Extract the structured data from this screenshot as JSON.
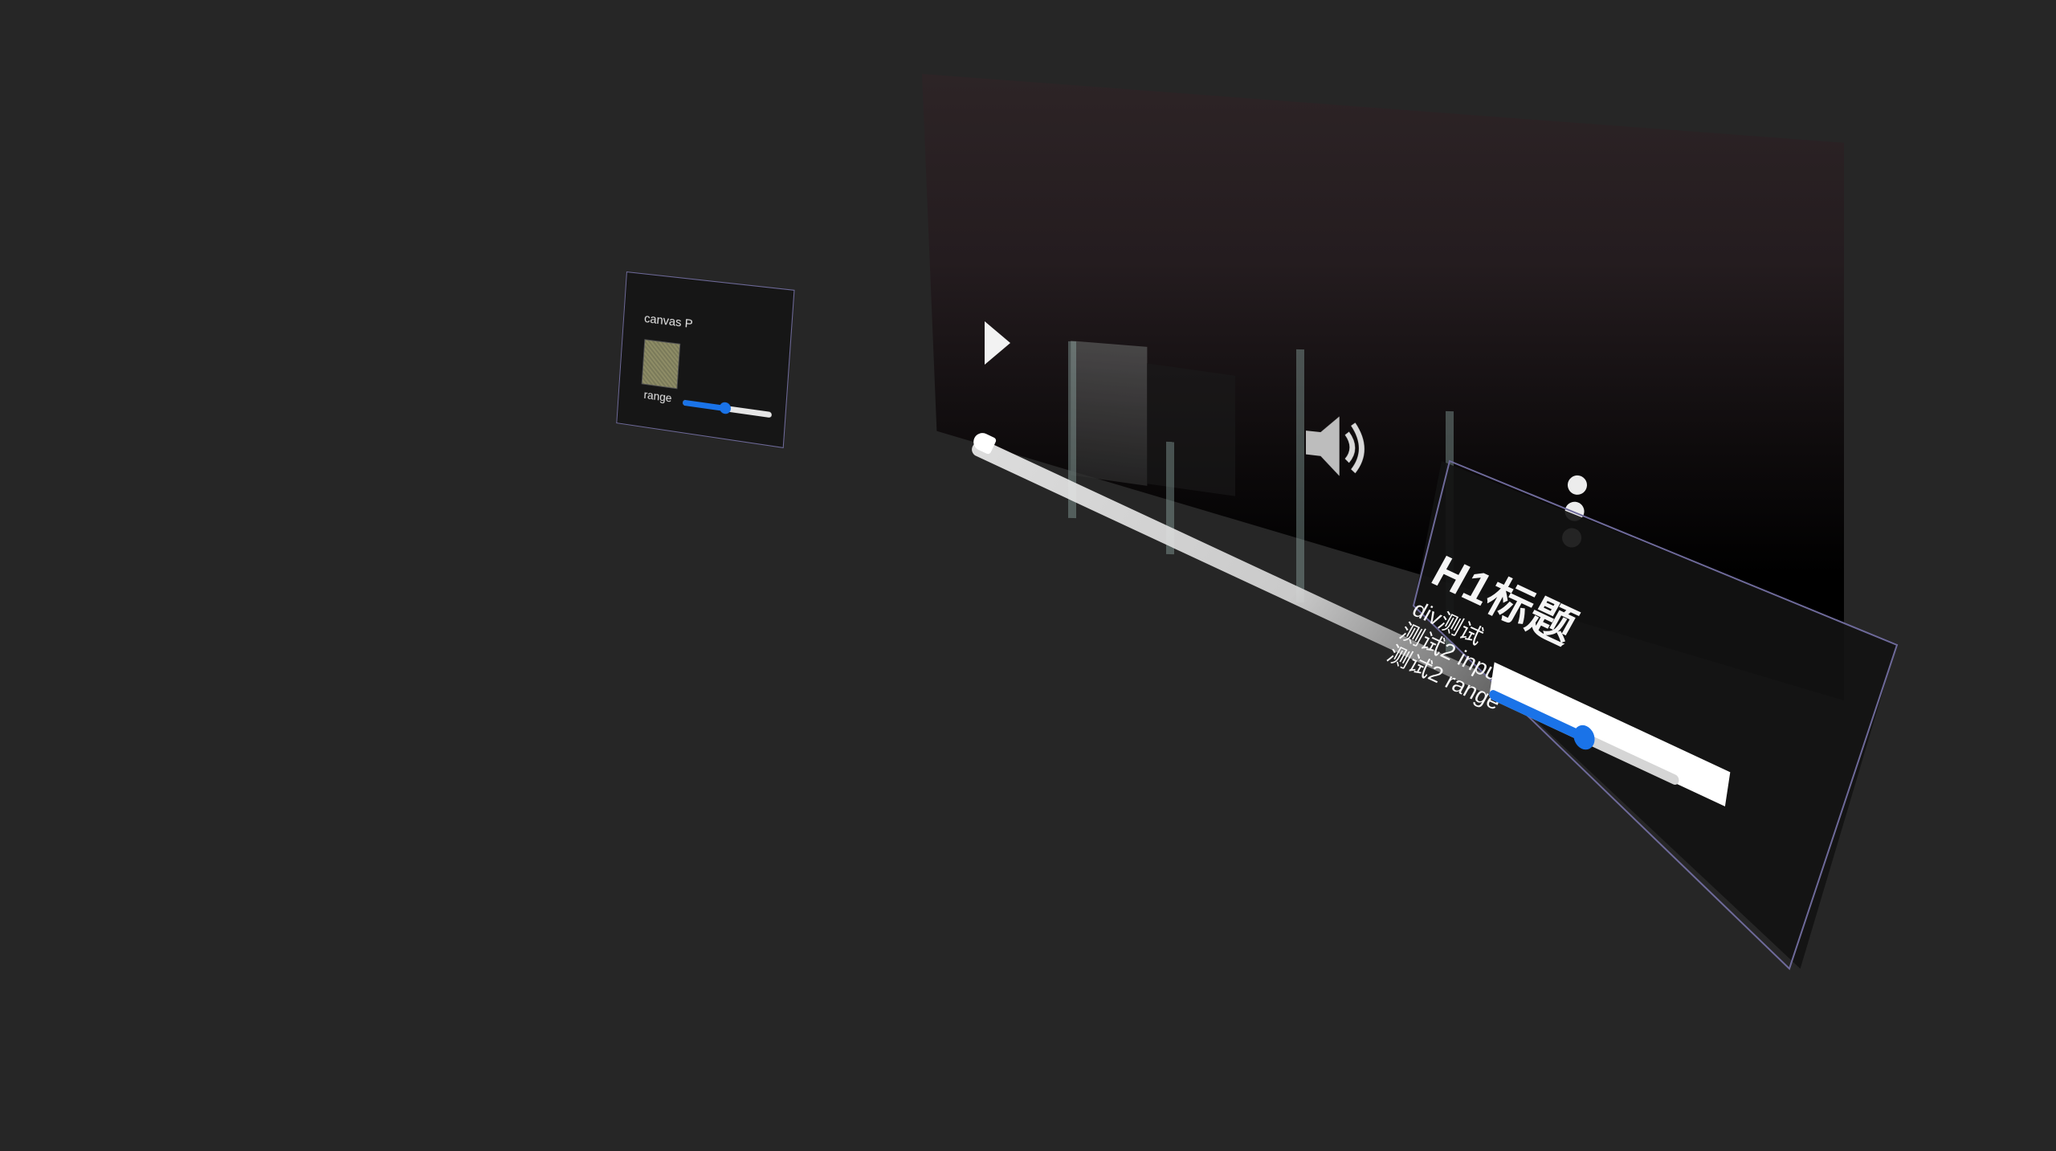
{
  "small_panel": {
    "title": "canvas P",
    "range_label": "range",
    "range_value": 0.48
  },
  "video_player": {
    "seek_progress": 0.02
  },
  "form_panel": {
    "heading": "H1标题",
    "div_text": "div测试",
    "input_label": "测试2 input",
    "input_value": "",
    "range_label": "测试2 range",
    "range_value": 0.5
  },
  "colors": {
    "background": "#262626",
    "accent": "#1a73e8",
    "panel_border": "#6e6a9a"
  },
  "icons": {
    "play": "play-icon",
    "volume": "volume-icon",
    "menu": "more-vertical-icon"
  }
}
